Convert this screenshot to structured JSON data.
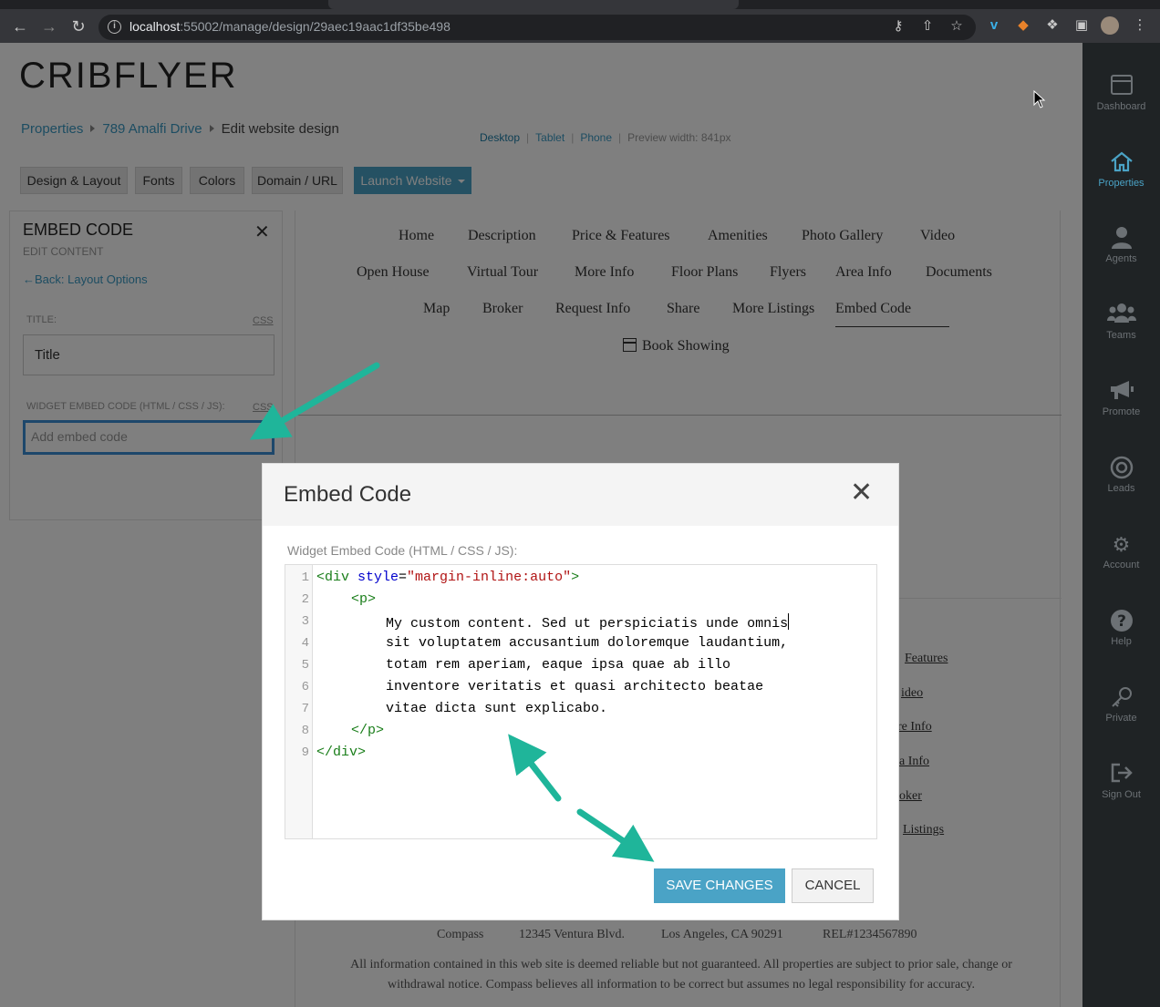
{
  "browser": {
    "url_host": "localhost",
    "url_rest": ":55002/manage/design/29aec19aac1df35be498"
  },
  "app": {
    "logo": "CRIBFLYER"
  },
  "breadcrumb": {
    "items": [
      "Properties",
      "789 Amalfi Drive"
    ],
    "current": "Edit website design"
  },
  "toolbar": {
    "buttons": [
      "Design & Layout",
      "Fonts",
      "Colors",
      "Domain / URL"
    ],
    "launch": "Launch Website",
    "devices": [
      "Desktop",
      "Tablet",
      "Phone"
    ],
    "preview_width": "Preview width: 841px"
  },
  "left_panel": {
    "title": "EMBED CODE",
    "subtitle": "EDIT CONTENT",
    "back": "Back: Layout Options",
    "title_label": "TITLE:",
    "css": "CSS",
    "title_value": "Title",
    "embed_label": "WIDGET EMBED CODE (HTML / CSS / JS):",
    "embed_placeholder": "Add embed code"
  },
  "preview_nav": {
    "row1": [
      "Home",
      "Description",
      "Price & Features",
      "Amenities",
      "Photo Gallery",
      "Video"
    ],
    "row2": [
      "Open House",
      "Virtual Tour",
      "More Info",
      "Floor Plans",
      "Flyers",
      "Area Info",
      "Documents"
    ],
    "row3": [
      "Map",
      "Broker",
      "Request Info",
      "Share",
      "More Listings",
      "Embed Code"
    ],
    "book": "Book Showing"
  },
  "preview_side_links": [
    "Features",
    "ideo",
    "re Info",
    "a Info",
    "oker",
    "Listings"
  ],
  "preview_footer": {
    "broker": "Compass",
    "address": "12345 Ventura Blvd.",
    "city": "Los Angeles, CA 90291",
    "rel": "REL#1234567890",
    "disclaimer": "All information contained in this web site is deemed reliable but not guaranteed. All properties are subject to prior sale, change or withdrawal notice. Compass believes all information to be correct but assumes no legal responsibility for accuracy."
  },
  "sidebar": {
    "items": [
      "Dashboard",
      "Properties",
      "Agents",
      "Teams",
      "Promote",
      "Leads",
      "Account",
      "Help",
      "Private",
      "Sign Out"
    ],
    "active": "Properties"
  },
  "modal": {
    "title": "Embed Code",
    "label": "Widget Embed Code (HTML / CSS / JS):",
    "line_numbers": [
      "1",
      "2",
      "3",
      "4",
      "5",
      "6",
      "7",
      "8",
      "9"
    ],
    "code": {
      "l1_open": "<div ",
      "l1_attr": "style",
      "l1_eq": "=",
      "l1_str": "\"margin-inline:auto\"",
      "l1_close": ">",
      "l2": "<p>",
      "l3": "My custom content. Sed ut perspiciatis unde omnis",
      "l4": "sit voluptatem accusantium doloremque laudantium,",
      "l5": "totam rem aperiam, eaque ipsa quae ab illo",
      "l6": "inventore veritatis et quasi architecto beatae",
      "l7": "vitae dicta sunt explicabo.",
      "l8": "</p>",
      "l9": "</div>"
    },
    "save": "SAVE CHANGES",
    "cancel": "CANCEL"
  },
  "colors": {
    "accent": "#4aa3c6",
    "annotation_arrow": "#1fb59a",
    "sidebar_bg": "#1f2325"
  }
}
